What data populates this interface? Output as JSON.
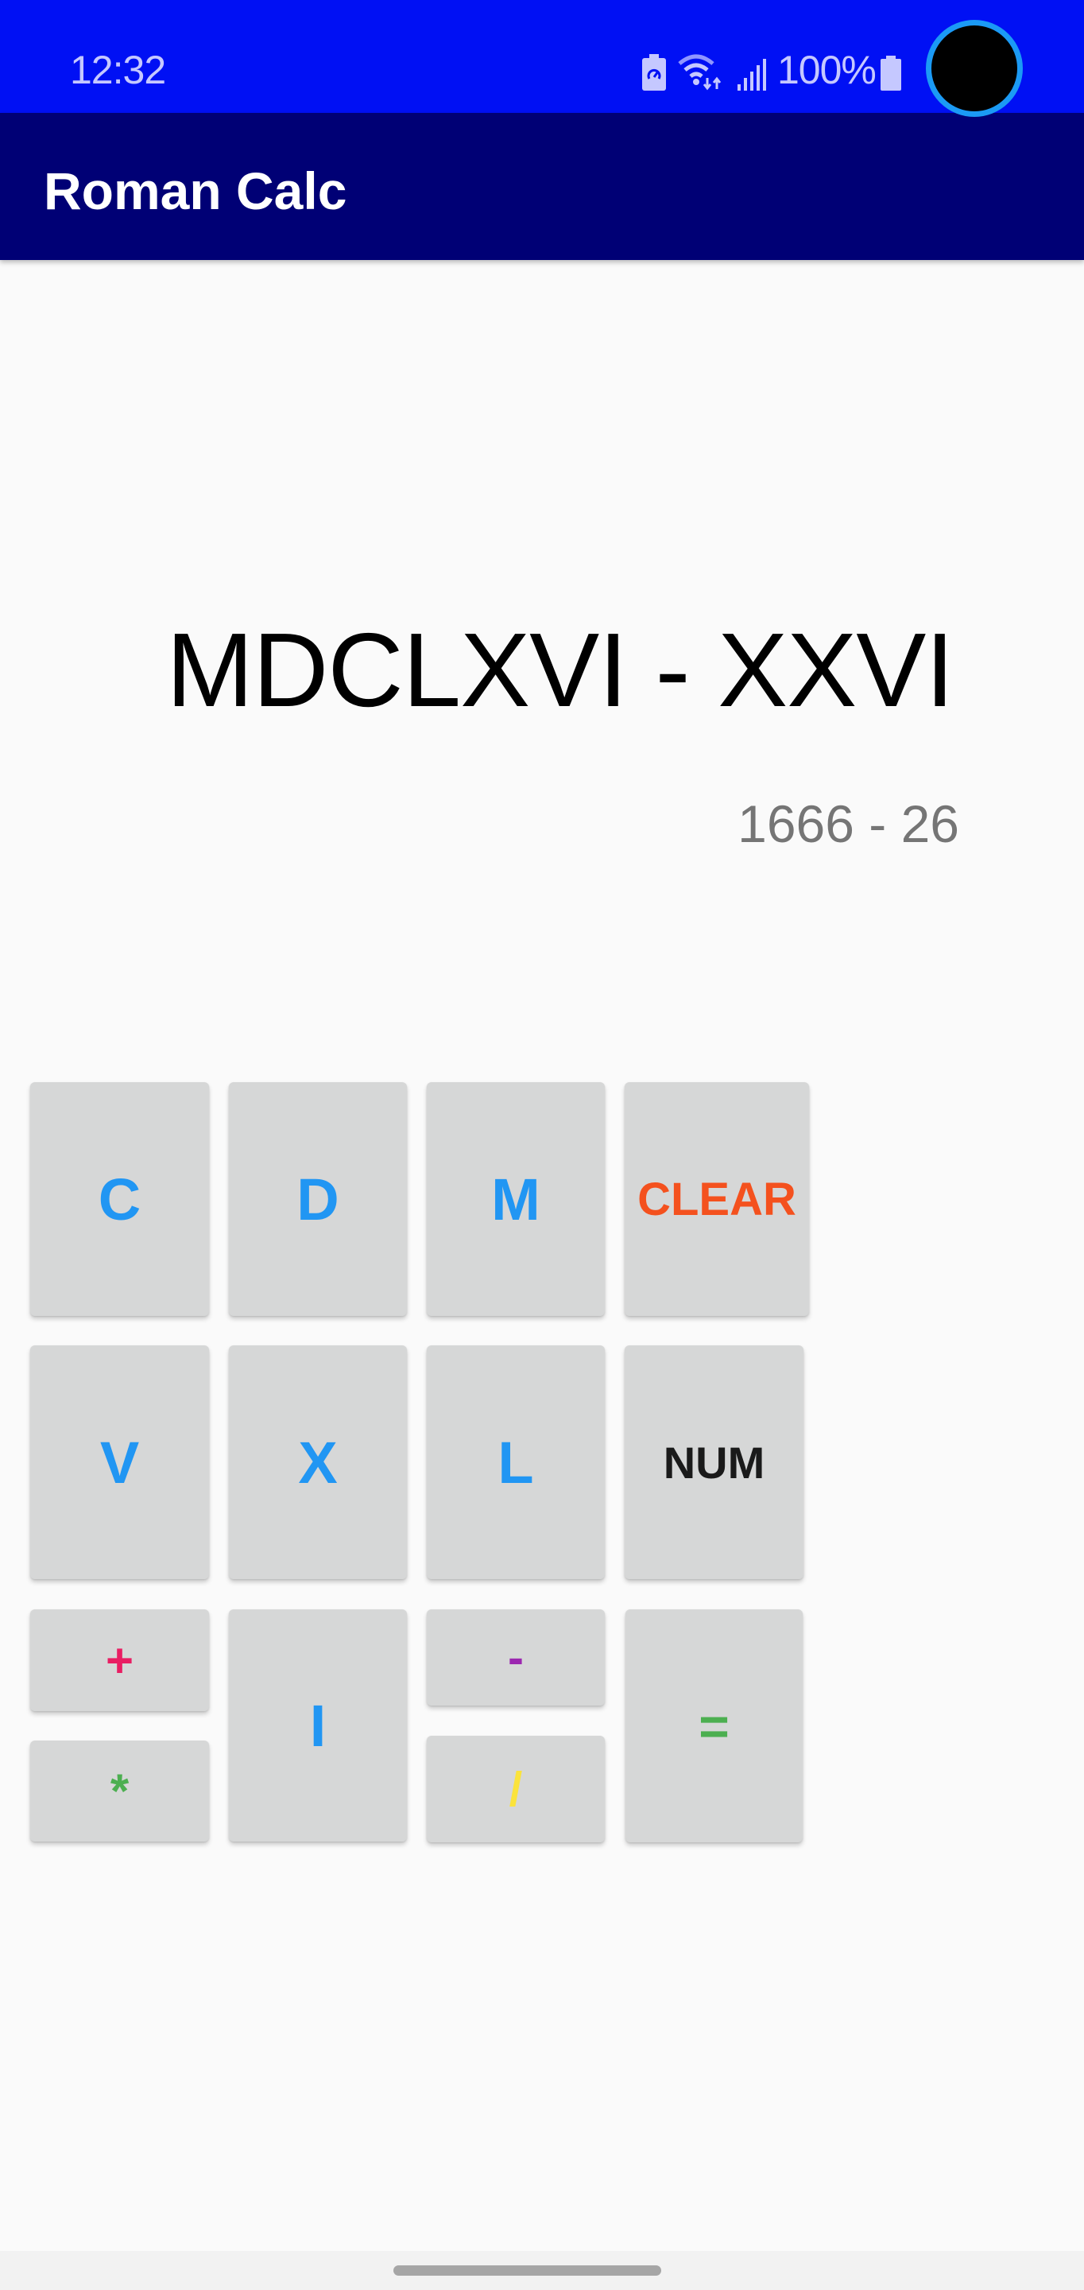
{
  "status_bar": {
    "time": "12:32",
    "battery_percent": "100%",
    "icons": [
      "battery-saver-icon",
      "wifi-icon",
      "signal-icon",
      "battery-icon"
    ]
  },
  "app_bar": {
    "title": "Roman Calc"
  },
  "display": {
    "expression_roman": "MDCLXVI - XXVI",
    "expression_decimal": "1666 - 26"
  },
  "keypad": {
    "c": {
      "label": "C",
      "color": "#2196f3"
    },
    "d": {
      "label": "D",
      "color": "#2196f3"
    },
    "m": {
      "label": "M",
      "color": "#2196f3"
    },
    "clear": {
      "label": "CLEAR",
      "color": "#f4511e"
    },
    "v": {
      "label": "V",
      "color": "#2196f3"
    },
    "x": {
      "label": "X",
      "color": "#2196f3"
    },
    "l": {
      "label": "L",
      "color": "#2196f3"
    },
    "num": {
      "label": "NUM",
      "color": "#1a1a1a"
    },
    "plus": {
      "label": "+",
      "color": "#e91e63"
    },
    "multiply": {
      "label": "*",
      "color": "#4caf50"
    },
    "i": {
      "label": "I",
      "color": "#2196f3"
    },
    "minus": {
      "label": "-",
      "color": "#9c27b0"
    },
    "divide": {
      "label": "/",
      "color": "#fbe33b"
    },
    "equals": {
      "label": "=",
      "color": "#4caf50"
    }
  },
  "colors": {
    "status_bar": "#0010f4",
    "app_bar": "#000075",
    "background": "#fafafa",
    "key_background": "#d6d7d7"
  }
}
